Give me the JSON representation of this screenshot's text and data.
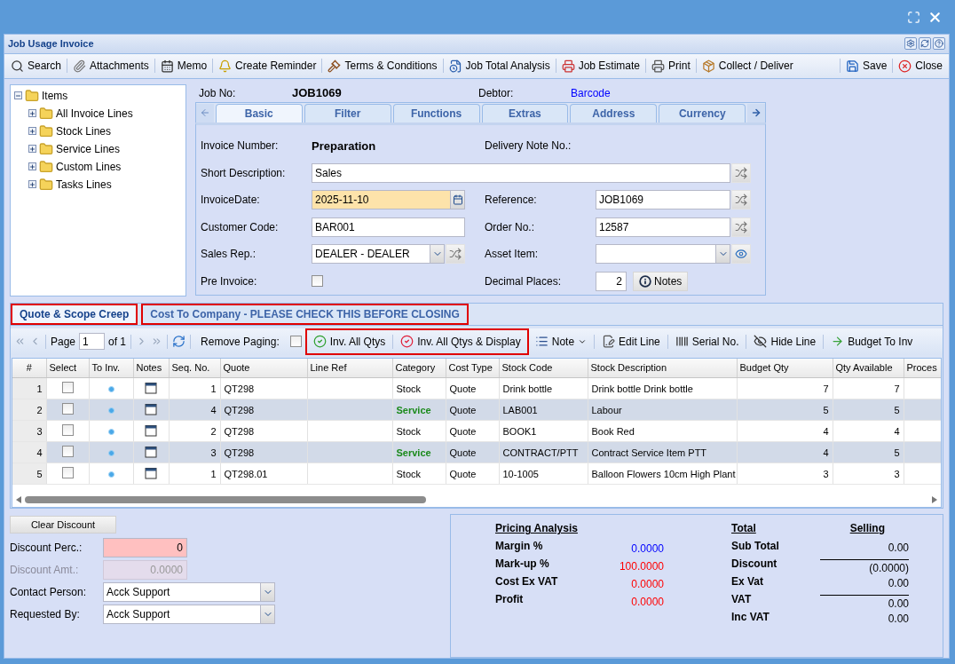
{
  "window": {
    "title": "Job Usage Invoice"
  },
  "toolbar": [
    {
      "label": "Search"
    },
    {
      "label": "Attachments"
    },
    {
      "label": "Memo"
    },
    {
      "label": "Create Reminder"
    },
    {
      "label": "Terms & Conditions"
    },
    {
      "label": "Job Total Analysis"
    },
    {
      "label": "Job Estimate"
    },
    {
      "label": "Print"
    },
    {
      "label": "Collect / Deliver"
    }
  ],
  "toolbar_right": [
    {
      "label": "Save"
    },
    {
      "label": "Close"
    }
  ],
  "tree": {
    "label": "Items",
    "expanded": true,
    "children": [
      {
        "label": "All Invoice Lines",
        "expanded": false
      },
      {
        "label": "Stock Lines",
        "expanded": false
      },
      {
        "label": "Service Lines",
        "expanded": false
      },
      {
        "label": "Custom Lines",
        "expanded": false
      },
      {
        "label": "Tasks Lines",
        "expanded": false
      }
    ]
  },
  "header": {
    "job_label": "Job No:",
    "job_no": "JOB1069",
    "debtor_label": "Debtor:",
    "debtor": "Barcode"
  },
  "form_tabs": [
    {
      "label": "Basic",
      "selected": true
    },
    {
      "label": "Filter",
      "selected": false
    },
    {
      "label": "Functions",
      "selected": false
    },
    {
      "label": "Extras",
      "selected": false
    },
    {
      "label": "Address",
      "selected": false
    },
    {
      "label": "Currency",
      "selected": false
    }
  ],
  "form_rows": [
    {
      "left": {
        "label": "Invoice Number:",
        "kind": "static",
        "value": "Preparation"
      },
      "right": {
        "label": "Delivery Note No.:",
        "kind": "static"
      }
    },
    {
      "wide": {
        "label": "Short Description:",
        "kind": "text-shuffle",
        "value": "Sales"
      }
    },
    {
      "left": {
        "label": "InvoiceDate:",
        "kind": "date",
        "value": "2025-11-10",
        "highlighted": true
      },
      "right": {
        "label": "Reference:",
        "kind": "text-shuffle",
        "value": "JOB1069"
      }
    },
    {
      "left": {
        "label": "Customer Code:",
        "kind": "text",
        "value": "BAR001"
      },
      "right": {
        "label": "Order No.:",
        "kind": "text-shuffle",
        "value": "12587"
      }
    },
    {
      "left": {
        "label": "Sales Rep.:",
        "kind": "select-shuffle",
        "value": "DEALER - DEALER"
      },
      "right": {
        "label": "Asset Item:",
        "kind": "select-eye"
      }
    },
    {
      "left": {
        "label": "Pre Invoice:",
        "kind": "checkbox",
        "checked": false
      },
      "right": {
        "label": "Decimal Places:",
        "kind": "number-notes",
        "value": "2",
        "button": "Notes"
      }
    }
  ],
  "grid_tabs": [
    {
      "label": "Quote & Scope Creep",
      "selected": true,
      "highlighted": true
    },
    {
      "label": "Cost To Company - PLEASE CHECK THIS BEFORE CLOSING",
      "selected": false,
      "highlighted": true
    }
  ],
  "pager": {
    "label": "Page",
    "page": "1",
    "of": "of 1",
    "remove_paging": "Remove Paging:",
    "remove_paging_checked": false
  },
  "grid_actions_highlighted": [
    {
      "label": "Inv. All Qtys"
    },
    {
      "label": "Inv. All Qtys & Display"
    }
  ],
  "grid_actions": [
    {
      "label": "Note"
    },
    {
      "label": "Edit Line"
    },
    {
      "label": "Serial No."
    },
    {
      "label": "Hide Line"
    },
    {
      "label": "Budget To Inv"
    }
  ],
  "grid": {
    "columns": [
      "#",
      "Select",
      "To Inv.",
      "Notes",
      "Seq. No.",
      "Quote",
      "Line Ref",
      "Category",
      "Cost Type",
      "Stock Code",
      "Stock Description",
      "Budget Qty",
      "Qty Available",
      "Proces"
    ],
    "rows": [
      {
        "num": "1",
        "checked": false,
        "seq": "1",
        "quote": "QT298",
        "category": "Stock",
        "kind": "stock",
        "cost_type": "Quote",
        "stock_code": "Drink bottle",
        "description": "Drink bottle Drink bottle",
        "budget_qty": "7",
        "qty_available": "7",
        "selected": false
      },
      {
        "num": "2",
        "checked": false,
        "seq": "4",
        "quote": "QT298",
        "category": "Service",
        "kind": "service",
        "cost_type": "Quote",
        "stock_code": "LAB001",
        "description": "Labour",
        "budget_qty": "5",
        "qty_available": "5",
        "selected": true
      },
      {
        "num": "3",
        "checked": false,
        "seq": "2",
        "quote": "QT298",
        "category": "Stock",
        "kind": "stock",
        "cost_type": "Quote",
        "stock_code": "BOOK1",
        "description": "Book Red",
        "budget_qty": "4",
        "qty_available": "4",
        "selected": false
      },
      {
        "num": "4",
        "checked": false,
        "seq": "3",
        "quote": "QT298",
        "category": "Service",
        "kind": "service",
        "cost_type": "Quote",
        "stock_code": "CONTRACT/PTT",
        "description": "Contract Service Item PTT",
        "budget_qty": "4",
        "qty_available": "5",
        "selected": true
      },
      {
        "num": "5",
        "checked": false,
        "seq": "1",
        "quote": "QT298.01",
        "category": "Stock",
        "kind": "stock",
        "cost_type": "Quote",
        "stock_code": "10-1005",
        "description": "Balloon Flowers 10cm High Plant",
        "budget_qty": "3",
        "qty_available": "3",
        "selected": false
      }
    ]
  },
  "discount": {
    "button": "Clear Discount",
    "fields": [
      {
        "label": "Discount Perc.:",
        "kind": "number",
        "value": "0",
        "highlighted": true,
        "disabled": false
      },
      {
        "label": "Discount Amt.:",
        "kind": "number",
        "value": "0.0000",
        "highlighted": false,
        "disabled": true
      },
      {
        "label": "Contact Person:",
        "kind": "select",
        "value": "Acck Support",
        "highlighted": false,
        "disabled": false
      },
      {
        "label": "Requested By:",
        "kind": "select",
        "value": "Acck Support",
        "highlighted": false,
        "disabled": false
      }
    ]
  },
  "pricing_analysis": {
    "title": "Pricing Analysis",
    "rows": [
      {
        "label": "Margin %",
        "value": "0.0000",
        "color": "#0000ff"
      },
      {
        "label": "Mark-up %",
        "value": "100.0000",
        "color": "#ff0000"
      },
      {
        "label": "Cost Ex VAT",
        "value": "0.0000",
        "color": "#ff0000"
      },
      {
        "label": "Profit",
        "value": "0.0000",
        "color": "#ff0000"
      }
    ]
  },
  "totals": {
    "title": "Total",
    "column": "Selling",
    "rows": [
      {
        "label": "Sub Total",
        "value": "0.00",
        "overline": false
      },
      {
        "label": "Discount",
        "value": "(0.0000)",
        "overline": true
      },
      {
        "label": "Ex Vat",
        "value": "0.00",
        "overline": false
      },
      {
        "label": "VAT",
        "value": "0.00",
        "overline": true
      },
      {
        "label": "Inc VAT",
        "value": "0.00",
        "overline": false
      }
    ]
  }
}
